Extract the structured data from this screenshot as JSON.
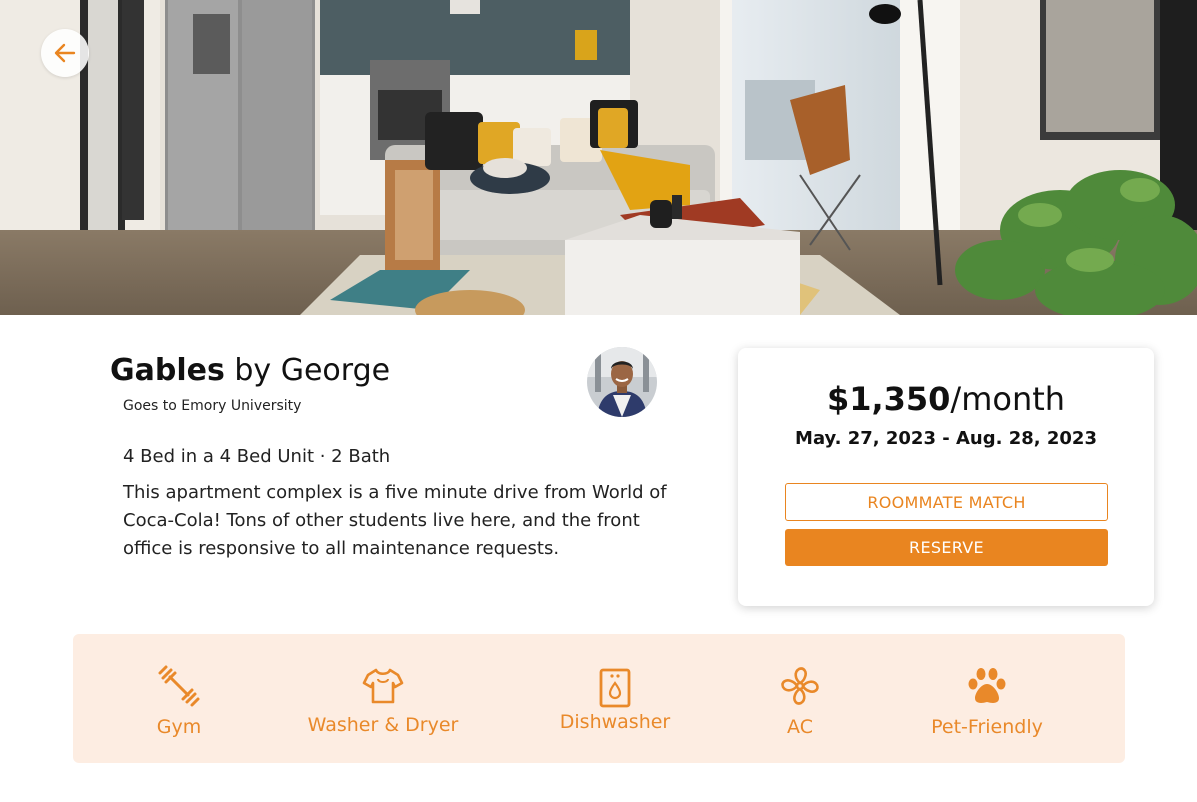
{
  "hero": {
    "back_label": "back"
  },
  "listing": {
    "name": "Gables",
    "by_text": " by George",
    "school": "Goes to Emory University",
    "unit_info": "4 Bed in a 4 Bed Unit ·  2 Bath",
    "description": "This apartment complex is a five minute drive from World of Coca-Cola! Tons of other students live here, and the front office is responsive to all maintenance requests."
  },
  "pricing": {
    "price": "$1,350",
    "period": "/month",
    "dates": "May. 27, 2023 - Aug. 28, 2023",
    "roommate_button": "ROOMMATE MATCH",
    "reserve_button": "RESERVE"
  },
  "amenities": [
    {
      "label": "Gym",
      "icon": "dumbbell-icon"
    },
    {
      "label": "Washer & Dryer",
      "icon": "shirt-icon"
    },
    {
      "label": "Dishwasher",
      "icon": "dishwasher-icon"
    },
    {
      "label": "AC",
      "icon": "fan-icon"
    },
    {
      "label": "Pet-Friendly",
      "icon": "paw-icon"
    }
  ],
  "colors": {
    "accent": "#E98520",
    "amenity_bg": "#FDEDE2"
  }
}
